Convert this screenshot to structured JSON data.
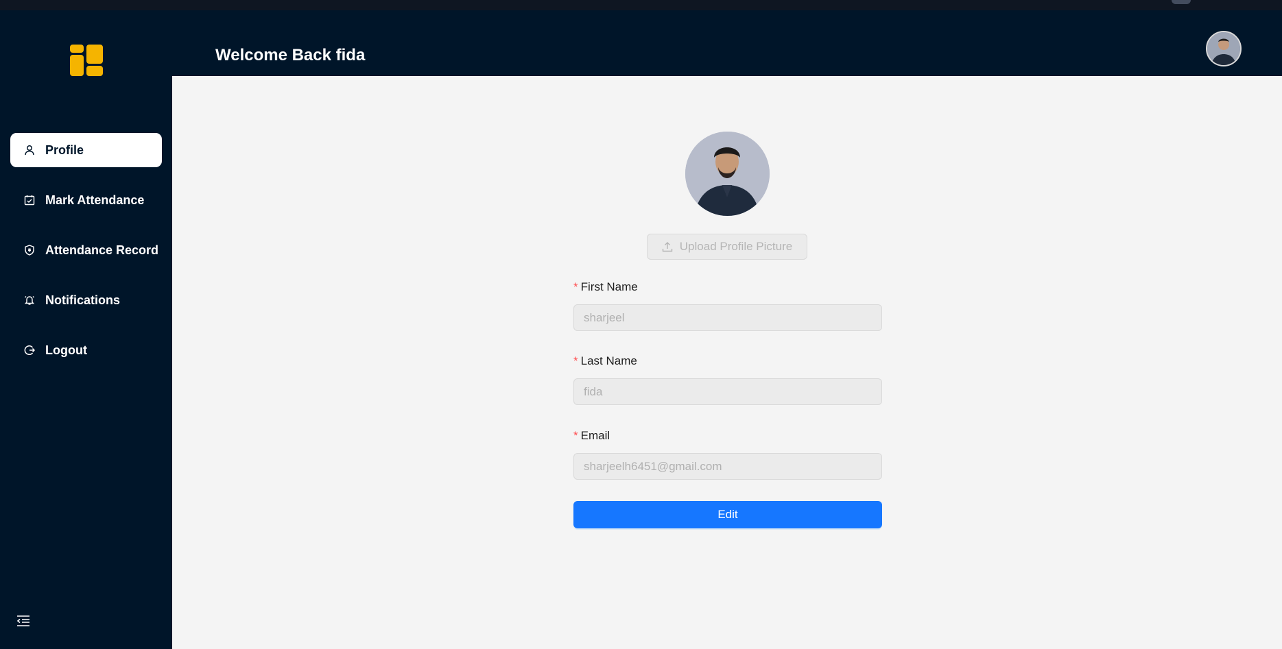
{
  "header": {
    "title": "Welcome Back fida"
  },
  "sidebar": {
    "items": [
      {
        "label": "Profile",
        "icon": "user-icon",
        "active": true
      },
      {
        "label": "Mark Attendance",
        "icon": "calendar-check-icon",
        "active": false
      },
      {
        "label": "Attendance Record",
        "icon": "shield-icon",
        "active": false
      },
      {
        "label": "Notifications",
        "icon": "bell-icon",
        "active": false
      },
      {
        "label": "Logout",
        "icon": "logout-icon",
        "active": false
      }
    ]
  },
  "profile": {
    "upload_label": "Upload Profile Picture",
    "fields": [
      {
        "label": "First Name",
        "value": "sharjeel"
      },
      {
        "label": "Last Name",
        "value": "fida"
      },
      {
        "label": "Email",
        "value": "sharjeelh6451@gmail.com"
      }
    ],
    "required_mark": "*",
    "edit_label": "Edit"
  },
  "colors": {
    "sidebar_bg": "#001529",
    "content_bg": "#f4f4f4",
    "primary": "#1677ff",
    "logo": "#f5b400",
    "required": "#ff4d4f"
  }
}
